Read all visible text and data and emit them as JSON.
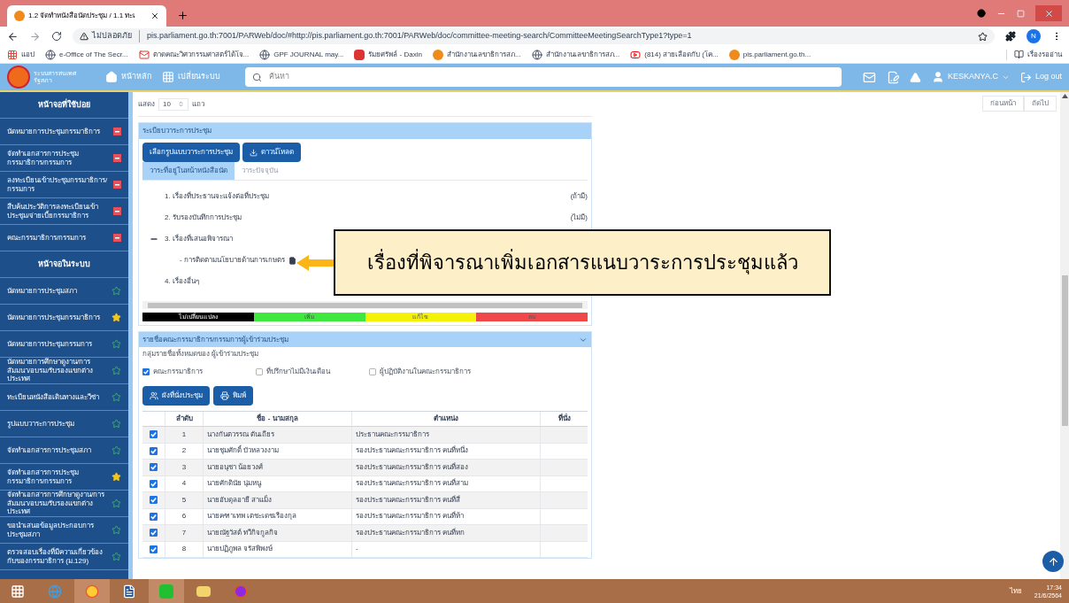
{
  "browser": {
    "tab": {
      "title": "1.2 จัดทำหนังสือนัดประชุม / 1.1 ทะเ"
    },
    "security": "ไม่ปลอดภัย",
    "url": "pis.parliament.go.th:7001/PARWeb/doc/#http://pis.parliament.go.th:7001/PARWeb/doc/committee-meeting-search/CommitteeMeetingSearchType1?type=1",
    "bookmarks": [
      {
        "kind": "apps",
        "label": "แอป"
      },
      {
        "kind": "globe",
        "label": "e-Office of The Secr..."
      },
      {
        "kind": "mail",
        "label": "ตาดคณะวิศวกรรมศาสตร์ได้โจ..."
      },
      {
        "kind": "globe",
        "label": "GPF JOURNAL may..."
      },
      {
        "kind": "mark",
        "label": "รัมยศรัพล์ - Daxin"
      },
      {
        "kind": "orange",
        "label": "สำนักงานเลขาธิการสภ..."
      },
      {
        "kind": "globe",
        "label": "สำนักงานเลขาธิการสภ..."
      },
      {
        "kind": "video",
        "label": "(814) สายเลือดกับ (โค..."
      },
      {
        "kind": "orange",
        "label": "pis.parliament.go.th..."
      }
    ],
    "reading_list": "เรื่องรออ่าน",
    "profile": "N"
  },
  "header": {
    "logo_text": "ระบบสารสนเทศรัฐสภา",
    "nav": [
      "หน้าหลัก",
      "เปลี่ยนระบบ"
    ],
    "search": {
      "placeholder": "ค้นหา"
    },
    "user": "KESKANYA.C",
    "logout": "Log out"
  },
  "sidebar": {
    "sections": [
      {
        "title": "หน้าจอที่ใช้บ่อย",
        "items": [
          {
            "kind": "remove",
            "label": "นัดหมายการประชุมกรรมาธิการ"
          },
          {
            "kind": "remove",
            "label": "จัดทำเอกสารการประชุมกรรมาธิการ/กรรมการ"
          },
          {
            "kind": "remove",
            "label": "ลงทะเบียนเข้าประชุมกรรมาธิการ/กรรมการ"
          },
          {
            "kind": "remove",
            "label": "สืบค้นประวัติการลงทะเบียนเข้าประชุม/จ่ายเบี้ยกรรมาธิการ"
          },
          {
            "kind": "remove",
            "label": "คณะกรรมาธิการ/กรรมการ"
          }
        ]
      },
      {
        "title": "หน้าจอในระบบ",
        "items": [
          {
            "kind": "star",
            "starred": false,
            "label": "นัดหมายการประชุมสภา"
          },
          {
            "kind": "star",
            "starred": true,
            "label": "นัดหมายการประชุมกรรมาธิการ"
          },
          {
            "kind": "star",
            "starred": false,
            "label": "นัดหมายการประชุมกรรมการ"
          },
          {
            "kind": "star",
            "starred": false,
            "label": "นัดหมายการศึกษาดูงาน/การสัมมนา/อบรม/รับรองแขกต่างประเทศ"
          },
          {
            "kind": "star",
            "starred": false,
            "label": "ทะเบียนหนังสือเดินทางและวีซ่า"
          },
          {
            "kind": "star",
            "starred": false,
            "label": "รูปแบบวาระการประชุม"
          },
          {
            "kind": "star",
            "starred": false,
            "label": "จัดทำเอกสารการประชุมสภา"
          },
          {
            "kind": "star",
            "starred": true,
            "label": "จัดทำเอกสารการประชุมกรรมาธิการ/กรรมการ"
          },
          {
            "kind": "star",
            "starred": false,
            "label": "จัดทำเอกสารการศึกษาดูงาน/การสัมมนา/อบรม/รับรองแขกต่างประเทศ"
          },
          {
            "kind": "star",
            "starred": false,
            "label": "ขอนำเสนอข้อมูลประกอบการประชุมสภา"
          },
          {
            "kind": "star",
            "starred": false,
            "label": "ตรวจสอบเรื่องที่มีความเกี่ยวข้องกับของกรรมาธิการ (ม.129)"
          }
        ]
      }
    ]
  },
  "page_size": {
    "before": "แสดง",
    "value": "10",
    "after": "แถว"
  },
  "pagination": [
    "ก่อนหน้า",
    "ถัดไป"
  ],
  "agenda": {
    "title": "ระเบียบวาระการประชุม",
    "buttons": [
      {
        "kind": "plain",
        "label": "เลือกรูปแบบวาระการประชุม"
      },
      {
        "kind": "download",
        "label": "ดาวน์โหลด"
      }
    ],
    "tabs": [
      {
        "label": "วาระที่อยู่ในหน้าหนังสือนัด",
        "selected": true
      },
      {
        "label": "วาระปัจจุบัน",
        "selected": false
      }
    ],
    "items": [
      {
        "label": "1. เรื่องที่ประธานจะแจ้งต่อที่ประชุม",
        "note": "(ถ้ามี)",
        "expanded": false
      },
      {
        "label": "2. รับรองบันทึกการประชุม",
        "note": "(ไม่มี)",
        "expanded": false
      },
      {
        "label": "3. เรื่องที่เสนอพิจารณา",
        "expanded": true,
        "children": [
          {
            "label": "- การติดตามนโยบายด้านการเกษตร",
            "attachment": true
          }
        ]
      },
      {
        "label": "4. เรื่องอื่นๆ",
        "expanded": false
      }
    ],
    "legend": [
      {
        "label": "ไม่เปลี่ยนแปลง",
        "color": "#000000"
      },
      {
        "label": "เพิ่ม",
        "color": "#3ee83e"
      },
      {
        "label": "แก้ไข",
        "color": "#f5f20a"
      },
      {
        "label": "ลบ",
        "color": "#f04848"
      }
    ]
  },
  "callout": {
    "text": "เรื่องที่พิจารณาเพิ่มเอกสารแนบวาระการประชุมแล้ว"
  },
  "attendees": {
    "title": "รายชื่อคณะกรรมาธิการ/กรรมการผู้เข้าร่วมประชุม",
    "group_label": "กลุ่มรายชื่อทั้งหมดของ ผู้เข้าร่วมประชุม",
    "groups": [
      {
        "label": "คณะกรรมาธิการ",
        "checked": true
      },
      {
        "label": "ที่ปรึกษาไม่มีเงินเดือน",
        "checked": false
      },
      {
        "label": "ผู้ปฏิบัติงานในคณะกรรมาธิการ",
        "checked": false
      }
    ],
    "buttons": [
      {
        "kind": "seats",
        "label": "ผังที่นั่งประชุม"
      },
      {
        "kind": "print",
        "label": "พิมพ์"
      }
    ],
    "columns": [
      "ลำดับ",
      "ชื่อ - นามสกุล",
      "ตำแหน่ง",
      "ที่นั่ง"
    ],
    "rows": [
      {
        "checked": true,
        "no": "1",
        "name": "นางกันตวรรณ ตันเถียร",
        "position": "ประธานคณะกรรมาธิการ"
      },
      {
        "checked": true,
        "no": "2",
        "name": "นายชุมศักดิ์ บัวหลวงงาม",
        "position": "รองประธานคณะกรรมาธิการ คนที่หนึ่ง"
      },
      {
        "checked": true,
        "no": "3",
        "name": "นายอนุชา น้อยวงศ์",
        "position": "รองประธานคณะกรรมาธิการ คนที่สอง"
      },
      {
        "checked": true,
        "no": "4",
        "name": "นายศักดินัย นุ่มหนู",
        "position": "รองประธานคณะกรรมาธิการ คนที่สาม"
      },
      {
        "checked": true,
        "no": "5",
        "name": "นายอับดุลอายี สาแม็ง",
        "position": "รองประธานคณะกรรมาธิการ คนที่สี่"
      },
      {
        "checked": true,
        "no": "6",
        "name": "นายคฑาเทพ เตชะเดชเรืองกุล",
        "position": "รองประธานคณะกรรมาธิการ คนที่ห้า"
      },
      {
        "checked": true,
        "no": "7",
        "name": "นายณัฐวัสต์ ทวีกิจกูลกิจ",
        "position": "รองประธานคณะกรรมาธิการ คนที่หก"
      },
      {
        "checked": true,
        "no": "8",
        "name": "นายปฏิภูพล จรัสพิพงษ์",
        "position": "-"
      }
    ]
  },
  "taskbar": {
    "language": "ไทย",
    "time": "17:34",
    "date": "21/6/2564"
  }
}
